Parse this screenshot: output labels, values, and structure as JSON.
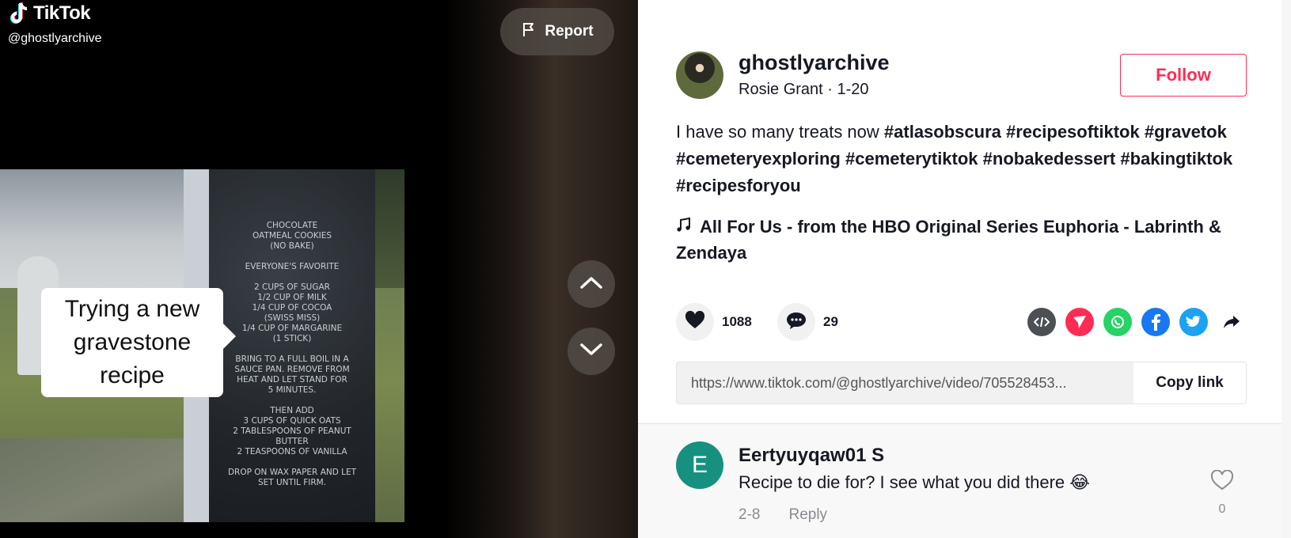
{
  "logo": {
    "text": "TikTok",
    "icon": "tiktok-logo-icon"
  },
  "video": {
    "handle": "@ghostlyarchive",
    "caption_overlay": "Trying a new gravestone recipe",
    "gravestone_text": "CHOCOLATE\nOATMEAL COOKIES\n(NO BAKE)\n\nEVERYONE'S FAVORITE\n\n2 CUPS OF SUGAR\n1/2 CUP OF MILK\n1/4 CUP OF COCOA\n(SWISS MISS)\n1/4 CUP OF MARGARINE\n(1 STICK)\n\nBRING TO A FULL BOIL IN A\nSAUCE PAN. REMOVE FROM\nHEAT AND LET STAND FOR\n5 MINUTES.\n\nTHEN ADD\n3 CUPS OF QUICK OATS\n2 TABLESPOONS OF PEANUT\nBUTTER\n2 TEASPOONS OF VANILLA\n\nDROP ON WAX PAPER AND LET\nSET UNTIL FIRM."
  },
  "report": {
    "label": "Report",
    "icon": "flag-icon"
  },
  "nav": {
    "up_icon": "chevron-up-icon",
    "down_icon": "chevron-down-icon"
  },
  "author": {
    "username": "ghostlyarchive",
    "subline": "Rosie Grant · 1-20",
    "follow_label": "Follow"
  },
  "description": {
    "text": "I have so many treats now ",
    "hashtags": [
      "#atlasobscura",
      "#recipesoftiktok",
      "#gravetok",
      "#cemeteryexploring",
      "#cemeterytiktok",
      "#nobakedessert",
      "#bakingtiktok",
      "#recipesforyou"
    ]
  },
  "music": {
    "title": "All For Us - from the HBO Original Series Euphoria - Labrinth & Zendaya",
    "icon": "music-note-icon"
  },
  "stats": {
    "likes": "1088",
    "comments": "29"
  },
  "share": {
    "icons": [
      "embed-icon",
      "send-icon",
      "whatsapp-icon",
      "facebook-icon",
      "twitter-icon",
      "share-arrow-icon"
    ],
    "colors": {
      "embed": "#4c4f54",
      "send": "#fe2c55",
      "whatsapp": "#25d366",
      "facebook": "#1877f2",
      "twitter": "#1da1f2"
    }
  },
  "link": {
    "url": "https://www.tiktok.com/@ghostlyarchive/video/705528453...",
    "copy_label": "Copy link"
  },
  "comment": {
    "avatar_letter": "E",
    "name": "Eertyuyqaw01 S",
    "text": "Recipe to die for? I see what you did there 😂",
    "date": "2-8",
    "reply_label": "Reply",
    "likes": "0"
  },
  "colors": {
    "accent": "#fe2c55",
    "avatar_bg": "#17917f"
  }
}
